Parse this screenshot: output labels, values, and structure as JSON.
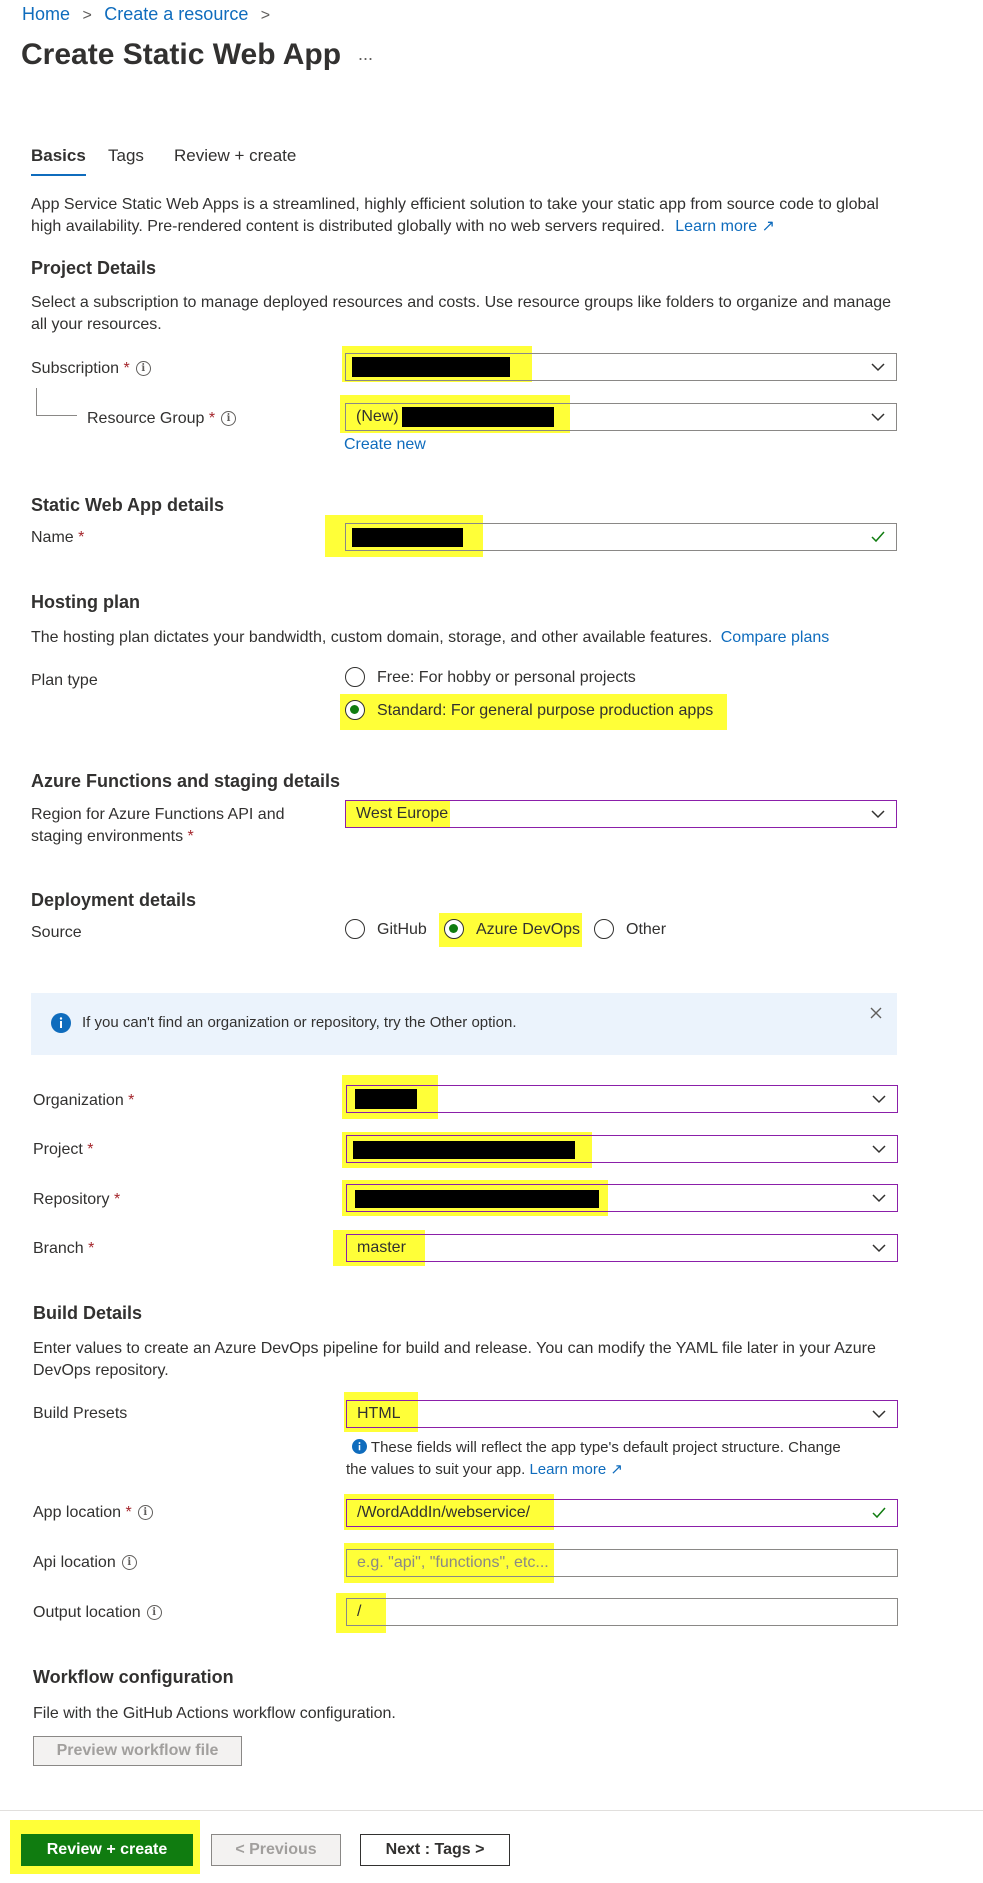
{
  "breadcrumb": {
    "home": "Home",
    "create_resource": "Create a resource",
    "sep": ">"
  },
  "page": {
    "title": "Create Static Web App",
    "more": "..."
  },
  "tabs": [
    {
      "label": "Basics"
    },
    {
      "label": "Tags"
    },
    {
      "label": "Review + create"
    }
  ],
  "intro": {
    "text": "App Service Static Web Apps is a streamlined, highly efficient solution to take your static app from source code to global high availability. Pre-rendered content is distributed globally with no web servers required.",
    "learn_more": "Learn more"
  },
  "project_details": {
    "heading": "Project Details",
    "description": "Select a subscription to manage deployed resources and costs. Use resource groups like folders to organize and manage all your resources.",
    "subscription_label": "Subscription",
    "resource_group_label": "Resource Group",
    "resource_group_prefix": "(New)",
    "create_new": "Create new"
  },
  "app_details": {
    "heading": "Static Web App details",
    "name_label": "Name"
  },
  "hosting": {
    "heading": "Hosting plan",
    "description": "The hosting plan dictates your bandwidth, custom domain, storage, and other available features.",
    "compare_plans": "Compare plans",
    "plan_type_label": "Plan type",
    "options": [
      {
        "label": "Free: For hobby or personal projects",
        "selected": false
      },
      {
        "label": "Standard: For general purpose production apps",
        "selected": true
      }
    ]
  },
  "functions": {
    "heading": "Azure Functions and staging details",
    "region_label_line1": "Region for Azure Functions API and",
    "region_label_line2": "staging environments",
    "region_value": "West Europe"
  },
  "deployment": {
    "heading": "Deployment details",
    "source_label": "Source",
    "sources": [
      {
        "label": "GitHub",
        "selected": false
      },
      {
        "label": "Azure DevOps",
        "selected": true
      },
      {
        "label": "Other",
        "selected": false
      }
    ],
    "info_text": "If you can't find an organization or repository, try the Other option.",
    "organization_label": "Organization",
    "project_label": "Project",
    "repository_label": "Repository",
    "branch_label": "Branch",
    "branch_value": "master"
  },
  "build": {
    "heading": "Build Details",
    "description": "Enter values to create an Azure DevOps pipeline for build and release. You can modify the YAML file later in your Azure DevOps repository.",
    "presets_label": "Build Presets",
    "presets_value": "HTML",
    "note_line1": "These fields will reflect the app type's default project structure. Change",
    "note_line2": "the values to suit your app.",
    "note_learn_more": "Learn more",
    "app_location_label": "App location",
    "app_location_value": "/WordAddIn/webservice/",
    "api_location_label": "Api location",
    "api_location_placeholder": "e.g. \"api\", \"functions\", etc...",
    "output_location_label": "Output location",
    "output_location_value": "/"
  },
  "workflow": {
    "heading": "Workflow configuration",
    "description": "File with the GitHub Actions workflow configuration.",
    "preview_button": "Preview workflow file"
  },
  "footer": {
    "review_create": "Review + create",
    "previous": "< Previous",
    "next": "Next : Tags >"
  },
  "colors": {
    "accent": "#0f6cbd",
    "primary_button": "#107c10",
    "highlight": "#ffff38",
    "required": "#a4262c",
    "info_bg": "#ebf3fc"
  }
}
